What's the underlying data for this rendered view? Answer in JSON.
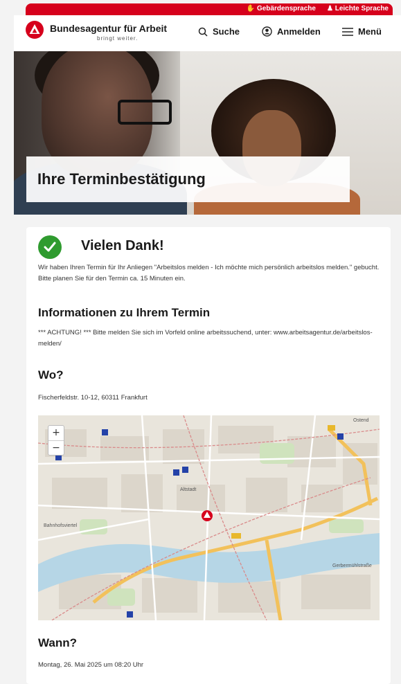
{
  "topbar": {
    "links": [
      {
        "label": "Gebärdensprache",
        "icon": "sign-language-icon"
      },
      {
        "label": "Leichte Sprache",
        "icon": "easy-language-icon"
      }
    ]
  },
  "header": {
    "brand": "Bundesagentur für Arbeit",
    "tagline": "bringt weiter.",
    "nav": {
      "search": "Suche",
      "login": "Anmelden",
      "menu": "Menü"
    }
  },
  "hero": {
    "title": "Ihre Terminbestätigung"
  },
  "confirmation": {
    "heading": "Vielen Dank!",
    "text": "Wir haben Ihren Termin für Ihr Anliegen \"Arbeitslos melden - Ich möchte mich persönlich arbeitslos melden.\" gebucht. Bitte planen Sie für den Termin ca. 15 Minuten ein."
  },
  "info": {
    "heading": "Informationen zu Ihrem Termin",
    "text": "*** ACHTUNG! *** Bitte melden Sie sich im Vorfeld online arbeitssuchend, unter: www.arbeitsagentur.de/arbeitslos-melden/"
  },
  "where": {
    "heading": "Wo?",
    "address": "Fischerfeldstr. 10-12, 60311 Frankfurt"
  },
  "map": {
    "zoom_in": "+",
    "zoom_out": "−",
    "labels": {
      "ostend": "Ostend",
      "bahnhofsviertel": "Bahnhofsviertel",
      "altstadt": "Altstadt",
      "gerbermuehlstrasse": "Gerbermühlstraße"
    }
  },
  "when": {
    "heading": "Wann?",
    "datetime": "Montag, 26. Mai 2025 um 08:20 Uhr"
  }
}
